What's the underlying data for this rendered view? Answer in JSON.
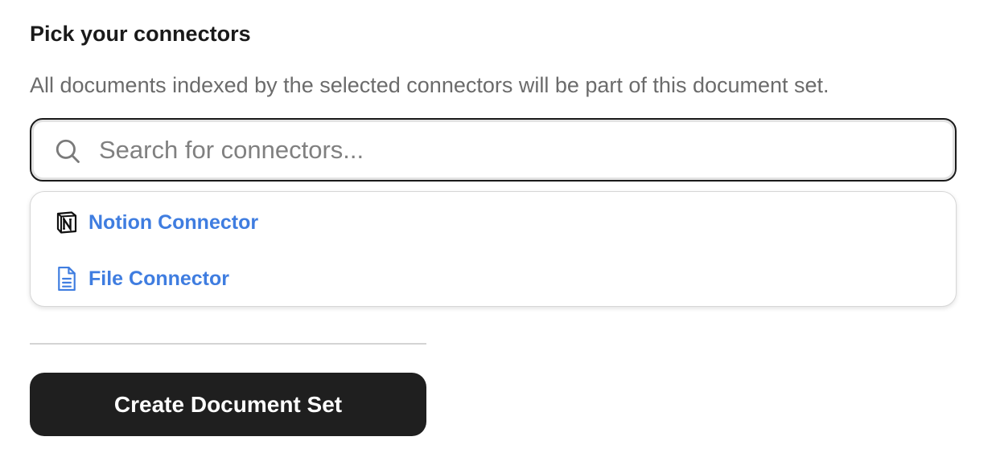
{
  "section": {
    "title": "Pick your connectors",
    "description": "All documents indexed by the selected connectors will be part of this document set."
  },
  "search": {
    "placeholder": "Search for connectors...",
    "value": "",
    "icon": "search-icon"
  },
  "dropdown": {
    "items": [
      {
        "label": "Notion Connector",
        "icon": "notion-icon"
      },
      {
        "label": "File Connector",
        "icon": "file-icon"
      }
    ]
  },
  "actions": {
    "create_label": "Create Document Set"
  },
  "colors": {
    "link": "#3f7de0",
    "button_bg": "#1f1f1f",
    "text": "#1a1a1a",
    "muted": "#6b6b6b"
  }
}
